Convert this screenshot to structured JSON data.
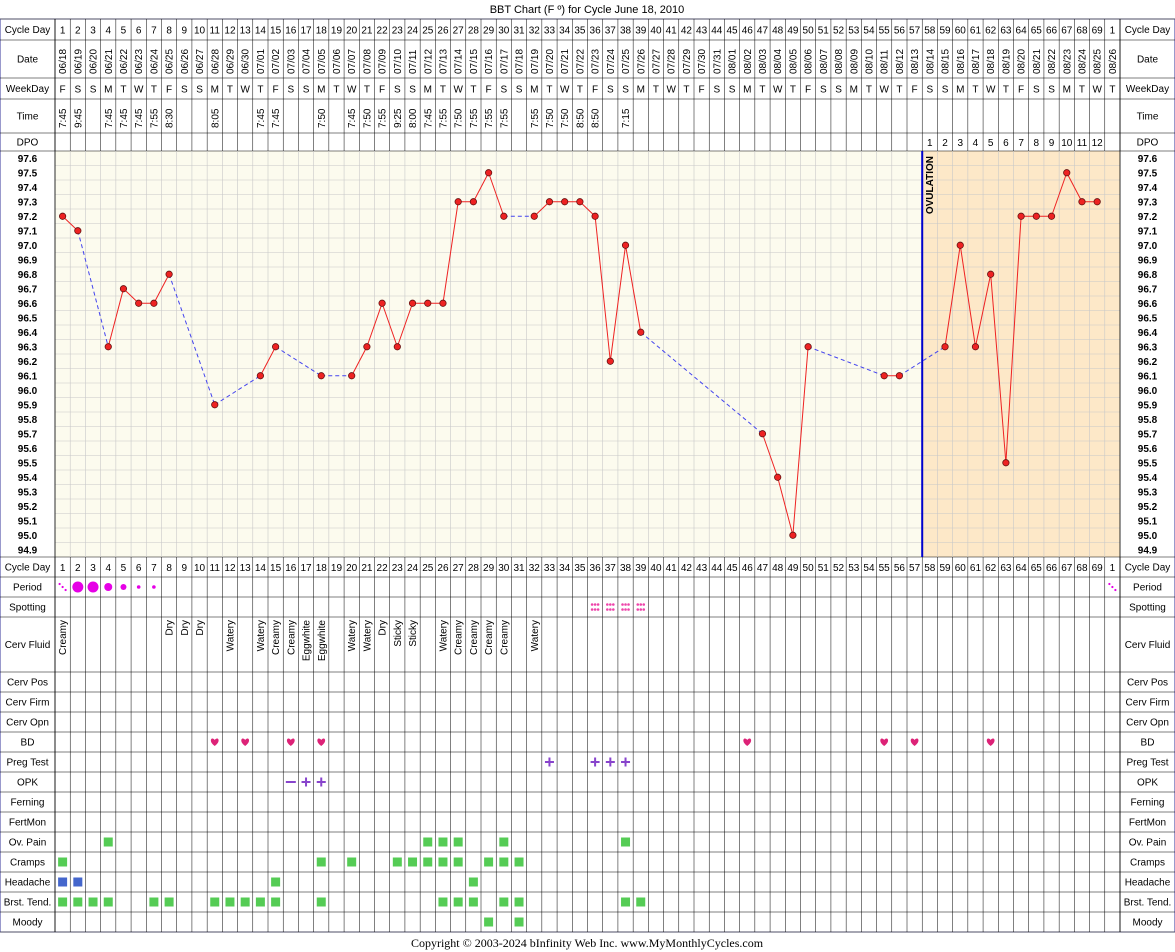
{
  "title": "BBT Chart (F º) for Cycle June 18, 2010",
  "copyright": "Copyright © 2003-2024 bInfinity Web Inc.      www.MyMonthlyCycles.com",
  "row_labels": {
    "cycle_day": "Cycle Day",
    "date": "Date",
    "weekday": "WeekDay",
    "time": "Time",
    "dpo": "DPO",
    "period": "Period",
    "spotting": "Spotting",
    "cerv_fluid": "Cerv Fluid",
    "cerv_pos": "Cerv Pos",
    "cerv_firm": "Cerv Firm",
    "cerv_opn": "Cerv Opn",
    "bd": "BD",
    "preg_test": "Preg Test",
    "opk": "OPK",
    "ferning": "Ferning",
    "fertmon": "FertMon",
    "ov_pain": "Ov. Pain",
    "cramps": "Cramps",
    "headache": "Headache",
    "brst_tend": "Brst. Tend.",
    "moody": "Moody"
  },
  "ovulation_label": "OVULATION",
  "colors": {
    "border": "#9999cc",
    "grid": "#c8c8c8",
    "plot_bg": "#fcfbee",
    "luteal_bg": "#fde8c8",
    "line": "#ee2222",
    "dash": "#4444ee",
    "point": "#ee2222",
    "ovulation_line": "#0000cc",
    "period": "#e600e6",
    "spotting": "#ee44aa",
    "heart": "#dd2277",
    "plus": "#8844cc",
    "green_sq": "#55cc55",
    "blue_sq": "#4466cc"
  },
  "cycle_days": [
    "1",
    "2",
    "3",
    "4",
    "5",
    "6",
    "7",
    "8",
    "9",
    "10",
    "11",
    "12",
    "13",
    "14",
    "15",
    "16",
    "17",
    "18",
    "19",
    "20",
    "21",
    "22",
    "23",
    "24",
    "25",
    "26",
    "27",
    "28",
    "29",
    "30",
    "31",
    "32",
    "33",
    "34",
    "35",
    "36",
    "37",
    "38",
    "39",
    "40",
    "41",
    "42",
    "43",
    "44",
    "45",
    "46",
    "47",
    "48",
    "49",
    "50",
    "51",
    "52",
    "53",
    "54",
    "55",
    "56",
    "57",
    "58",
    "59",
    "60",
    "61",
    "62",
    "63",
    "64",
    "65",
    "66",
    "67",
    "68",
    "69",
    "1"
  ],
  "dates": [
    "06/18",
    "06/19",
    "06/20",
    "06/21",
    "06/22",
    "06/23",
    "06/24",
    "06/25",
    "06/26",
    "06/27",
    "06/28",
    "06/29",
    "06/30",
    "07/01",
    "07/02",
    "07/03",
    "07/04",
    "07/05",
    "07/06",
    "07/07",
    "07/08",
    "07/09",
    "07/10",
    "07/11",
    "07/12",
    "07/13",
    "07/14",
    "07/15",
    "07/16",
    "07/17",
    "07/18",
    "07/19",
    "07/20",
    "07/21",
    "07/22",
    "07/23",
    "07/24",
    "07/25",
    "07/26",
    "07/27",
    "07/28",
    "07/29",
    "07/30",
    "07/31",
    "08/01",
    "08/02",
    "08/03",
    "08/04",
    "08/05",
    "08/06",
    "08/07",
    "08/08",
    "08/09",
    "08/10",
    "08/11",
    "08/12",
    "08/13",
    "08/14",
    "08/15",
    "08/16",
    "08/17",
    "08/18",
    "08/19",
    "08/20",
    "08/21",
    "08/22",
    "08/23",
    "08/24",
    "08/25",
    "08/26"
  ],
  "weekdays": [
    "F",
    "S",
    "S",
    "M",
    "T",
    "W",
    "T",
    "F",
    "S",
    "S",
    "M",
    "T",
    "W",
    "T",
    "F",
    "S",
    "S",
    "M",
    "T",
    "W",
    "T",
    "F",
    "S",
    "S",
    "M",
    "T",
    "W",
    "T",
    "F",
    "S",
    "S",
    "M",
    "T",
    "W",
    "T",
    "F",
    "S",
    "S",
    "M",
    "T",
    "W",
    "T",
    "F",
    "S",
    "S",
    "M",
    "T",
    "W",
    "T",
    "F",
    "S",
    "S",
    "M",
    "T",
    "W",
    "T",
    "F",
    "S",
    "S",
    "M",
    "T",
    "W",
    "T",
    "F",
    "S",
    "S",
    "M",
    "T",
    "W",
    "T"
  ],
  "times": [
    "7:45",
    "9:45",
    "",
    "7:45",
    "7:45",
    "7:45",
    "7:55",
    "8:30",
    "",
    "",
    "8:05",
    "",
    "",
    "7:45",
    "7:45",
    "",
    "",
    "7:50",
    "",
    "7:45",
    "7:50",
    "7:55",
    "9:25",
    "8:00",
    "7:45",
    "7:55",
    "7:50",
    "7:55",
    "7:55",
    "7:55",
    "",
    "7:55",
    "7:50",
    "7:50",
    "8:50",
    "8:50",
    "",
    "7:15",
    "",
    "",
    "",
    "",
    "",
    "",
    "",
    "",
    "",
    "",
    "",
    "",
    "",
    "",
    "",
    "",
    "",
    "",
    "",
    "",
    "",
    "",
    "",
    "",
    "",
    "",
    "",
    "",
    "",
    "",
    "",
    ""
  ],
  "dpo": [
    "",
    "",
    "",
    "",
    "",
    "",
    "",
    "",
    "",
    "",
    "",
    "",
    "",
    "",
    "",
    "",
    "",
    "",
    "",
    "",
    "",
    "",
    "",
    "",
    "",
    "",
    "",
    "",
    "",
    "",
    "",
    "",
    "",
    "",
    "",
    "",
    "",
    "",
    "",
    "",
    "",
    "",
    "",
    "",
    "",
    "",
    "",
    "",
    "",
    "",
    "",
    "",
    "",
    "",
    "",
    "",
    "",
    "1",
    "2",
    "3",
    "4",
    "5",
    "6",
    "7",
    "8",
    "9",
    "10",
    "11",
    "12",
    ""
  ],
  "y_ticks": [
    "97.6",
    "97.5",
    "97.4",
    "97.3",
    "97.2",
    "97.1",
    "97.0",
    "96.9",
    "96.8",
    "96.7",
    "96.6",
    "96.5",
    "96.4",
    "96.3",
    "96.2",
    "96.1",
    "96.0",
    "95.9",
    "95.8",
    "95.7",
    "95.6",
    "95.5",
    "95.4",
    "95.3",
    "95.2",
    "95.1",
    "95.0",
    "94.9"
  ],
  "chart_data": {
    "type": "line",
    "title": "BBT Chart (F º) for Cycle June 18, 2010",
    "xlabel": "Cycle Day",
    "ylabel": "",
    "ylim": [
      94.9,
      97.6
    ],
    "ovulation_day": 57,
    "temperatures": [
      {
        "day": 1,
        "temp": 97.2
      },
      {
        "day": 2,
        "temp": 97.1
      },
      {
        "day": 4,
        "temp": 96.3
      },
      {
        "day": 5,
        "temp": 96.7
      },
      {
        "day": 6,
        "temp": 96.6
      },
      {
        "day": 7,
        "temp": 96.6
      },
      {
        "day": 8,
        "temp": 96.8
      },
      {
        "day": 11,
        "temp": 95.9
      },
      {
        "day": 14,
        "temp": 96.1
      },
      {
        "day": 15,
        "temp": 96.3
      },
      {
        "day": 18,
        "temp": 96.1
      },
      {
        "day": 20,
        "temp": 96.1
      },
      {
        "day": 21,
        "temp": 96.3
      },
      {
        "day": 22,
        "temp": 96.6
      },
      {
        "day": 23,
        "temp": 96.3
      },
      {
        "day": 24,
        "temp": 96.6
      },
      {
        "day": 25,
        "temp": 96.6
      },
      {
        "day": 26,
        "temp": 96.6
      },
      {
        "day": 27,
        "temp": 97.3
      },
      {
        "day": 28,
        "temp": 97.3
      },
      {
        "day": 29,
        "temp": 97.5
      },
      {
        "day": 30,
        "temp": 97.2
      },
      {
        "day": 32,
        "temp": 97.2
      },
      {
        "day": 33,
        "temp": 97.3
      },
      {
        "day": 34,
        "temp": 97.3
      },
      {
        "day": 35,
        "temp": 97.3
      },
      {
        "day": 36,
        "temp": 97.2
      },
      {
        "day": 37,
        "temp": 96.2
      },
      {
        "day": 38,
        "temp": 97.0
      },
      {
        "day": 39,
        "temp": 96.4
      },
      {
        "day": 47,
        "temp": 95.7
      },
      {
        "day": 48,
        "temp": 95.4
      },
      {
        "day": 49,
        "temp": 95.0
      },
      {
        "day": 50,
        "temp": 96.3
      },
      {
        "day": 55,
        "temp": 96.1
      },
      {
        "day": 56,
        "temp": 96.1
      },
      {
        "day": 59,
        "temp": 96.3
      },
      {
        "day": 60,
        "temp": 97.0
      },
      {
        "day": 61,
        "temp": 96.3
      },
      {
        "day": 62,
        "temp": 96.8
      },
      {
        "day": 63,
        "temp": 95.5
      },
      {
        "day": 64,
        "temp": 97.2
      },
      {
        "day": 65,
        "temp": 97.2
      },
      {
        "day": 66,
        "temp": 97.2
      },
      {
        "day": 67,
        "temp": 97.5
      },
      {
        "day": 68,
        "temp": 97.3
      },
      {
        "day": 69,
        "temp": 97.3
      }
    ]
  },
  "period": [
    {
      "col": 1,
      "size": "spot"
    },
    {
      "col": 2,
      "size": "large"
    },
    {
      "col": 3,
      "size": "large"
    },
    {
      "col": 4,
      "size": "medium"
    },
    {
      "col": 5,
      "size": "small"
    },
    {
      "col": 6,
      "size": "tiny"
    },
    {
      "col": 7,
      "size": "tiny"
    },
    {
      "col": 70,
      "size": "spot"
    }
  ],
  "spotting_cols": [
    36,
    37,
    38,
    39
  ],
  "cerv_fluid": [
    {
      "col": 1,
      "text": "Creamy"
    },
    {
      "col": 8,
      "text": "Dry"
    },
    {
      "col": 9,
      "text": "Dry"
    },
    {
      "col": 10,
      "text": "Dry"
    },
    {
      "col": 12,
      "text": "Watery"
    },
    {
      "col": 14,
      "text": "Watery"
    },
    {
      "col": 15,
      "text": "Creamy"
    },
    {
      "col": 16,
      "text": "Creamy"
    },
    {
      "col": 17,
      "text": "Eggwhite"
    },
    {
      "col": 18,
      "text": "Eggwhite"
    },
    {
      "col": 20,
      "text": "Watery"
    },
    {
      "col": 21,
      "text": "Watery"
    },
    {
      "col": 22,
      "text": "Dry"
    },
    {
      "col": 23,
      "text": "Sticky"
    },
    {
      "col": 24,
      "text": "Sticky"
    },
    {
      "col": 26,
      "text": "Watery"
    },
    {
      "col": 27,
      "text": "Creamy"
    },
    {
      "col": 28,
      "text": "Creamy"
    },
    {
      "col": 29,
      "text": "Creamy"
    },
    {
      "col": 30,
      "text": "Creamy"
    },
    {
      "col": 32,
      "text": "Watery"
    }
  ],
  "bd_cols": [
    11,
    13,
    16,
    18,
    46,
    55,
    57,
    62
  ],
  "preg_test_cols": [
    33,
    36,
    37,
    38
  ],
  "opk": [
    {
      "col": 16,
      "mark": "–"
    },
    {
      "col": 17,
      "mark": "+"
    },
    {
      "col": 18,
      "mark": "+"
    }
  ],
  "ov_pain_cols": [
    4,
    25,
    26,
    27,
    30,
    38
  ],
  "cramps_cols": [
    1,
    18,
    20,
    23,
    24,
    25,
    26,
    27,
    29,
    30,
    31
  ],
  "headache_cols": [
    1,
    2,
    15,
    28
  ],
  "headache_blue_cols": [
    1,
    2
  ],
  "brst_tend_cols": [
    1,
    2,
    3,
    4,
    7,
    8,
    11,
    12,
    13,
    14,
    15,
    18,
    26,
    27,
    28,
    30,
    31,
    38,
    39
  ],
  "moody_cols": [
    29,
    31
  ]
}
